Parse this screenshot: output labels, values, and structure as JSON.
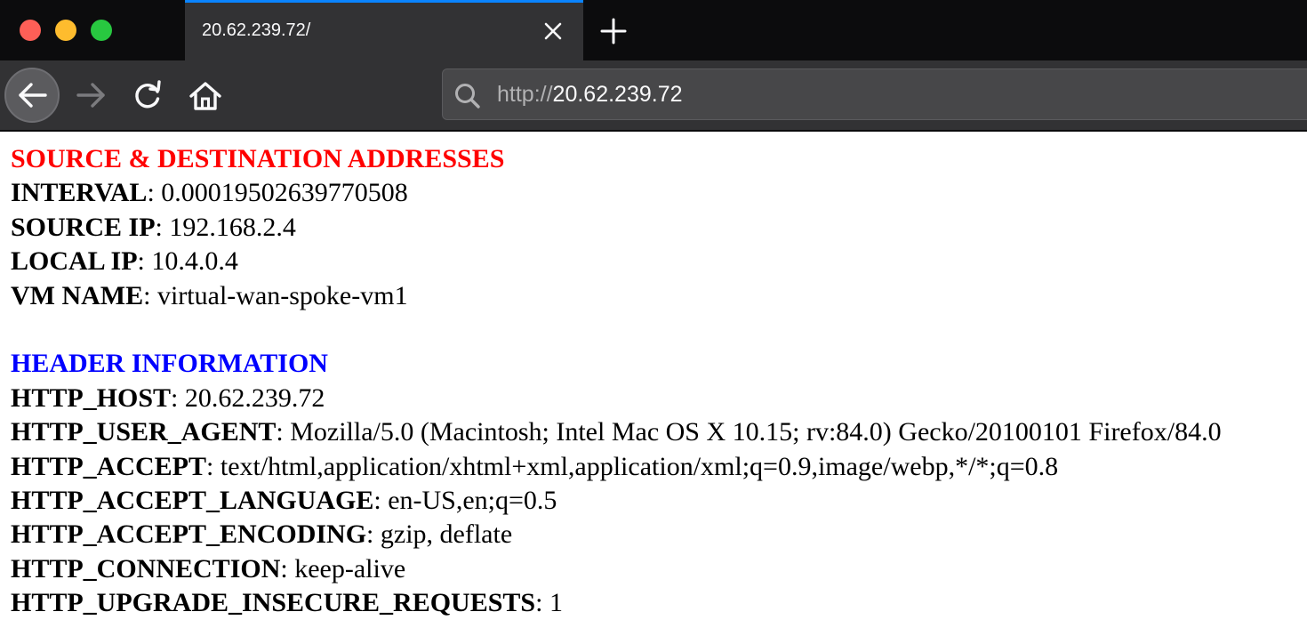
{
  "browser": {
    "tab_title": "20.62.239.72/",
    "url_scheme": "http://",
    "url_host": "20.62.239.72"
  },
  "colors": {
    "source_heading": "#ff0000",
    "header_heading": "#0000ff",
    "tab_accent": "#0a84ff"
  },
  "icons": {
    "close": "close-icon",
    "new_tab": "plus-icon",
    "back": "arrow-left-icon",
    "forward": "arrow-right-icon",
    "reload": "reload-icon",
    "home": "home-icon",
    "search": "search-icon"
  },
  "page": {
    "source_section": {
      "heading": "SOURCE & DESTINATION ADDRESSES",
      "rows": [
        {
          "key": "INTERVAL",
          "value": ": 0.00019502639770508"
        },
        {
          "key": "SOURCE IP",
          "value": ": 192.168.2.4"
        },
        {
          "key": "LOCAL IP",
          "value": ": 10.4.0.4"
        },
        {
          "key": "VM NAME",
          "value": ": virtual-wan-spoke-vm1"
        }
      ]
    },
    "header_section": {
      "heading": "HEADER INFORMATION",
      "rows": [
        {
          "key": "HTTP_HOST",
          "value": ": 20.62.239.72"
        },
        {
          "key": "HTTP_USER_AGENT",
          "value": ": Mozilla/5.0 (Macintosh; Intel Mac OS X 10.15; rv:84.0) Gecko/20100101 Firefox/84.0"
        },
        {
          "key": "HTTP_ACCEPT",
          "value": ": text/html,application/xhtml+xml,application/xml;q=0.9,image/webp,*/*;q=0.8"
        },
        {
          "key": "HTTP_ACCEPT_LANGUAGE",
          "value": ": en-US,en;q=0.5"
        },
        {
          "key": "HTTP_ACCEPT_ENCODING",
          "value": ": gzip, deflate"
        },
        {
          "key": "HTTP_CONNECTION",
          "value": ": keep-alive"
        },
        {
          "key": "HTTP_UPGRADE_INSECURE_REQUESTS",
          "value": ": 1"
        }
      ]
    }
  }
}
